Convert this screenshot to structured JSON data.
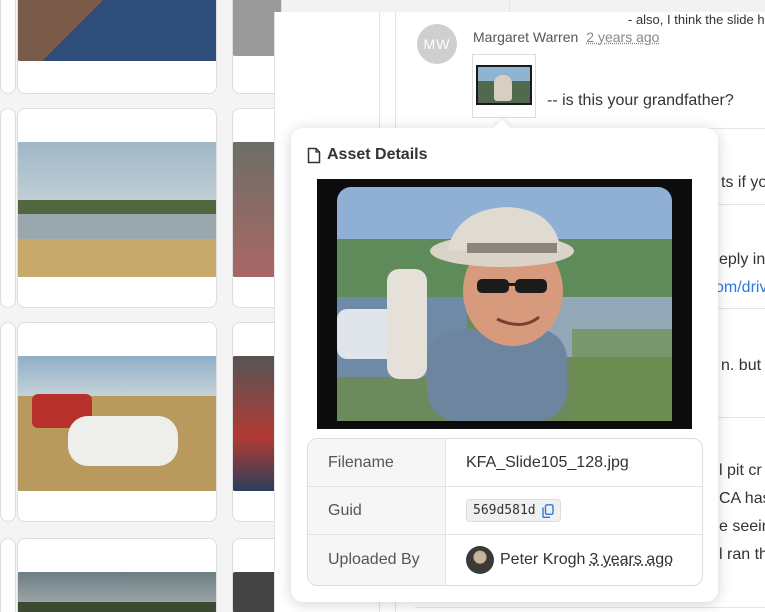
{
  "comments": {
    "top_snippet": "- also, I think the slide h",
    "comment": {
      "author_initials": "MW",
      "author": "Margaret Warren",
      "time": "2 years ago",
      "text": "-- is this your grandfather?"
    },
    "clipped_lines": [
      "ts if yo",
      "eply in",
      "om/driv",
      "n. but",
      "l pit cr",
      "CA has",
      "e seein",
      "l ran th"
    ]
  },
  "asset_details": {
    "title": "Asset Details",
    "rows": {
      "filename_label": "Filename",
      "filename_value": "KFA_Slide105_128.jpg",
      "guid_label": "Guid",
      "guid_value": "569d581d",
      "uploaded_label": "Uploaded By",
      "uploader_name": "Peter Krogh",
      "uploaded_time": "3 years ago"
    }
  },
  "icons": {
    "title_icon": "document-icon",
    "copy_icon": "copy-icon"
  },
  "colors": {
    "link": "#2a7ae2",
    "avatar_bg": "#cfcfcf"
  }
}
